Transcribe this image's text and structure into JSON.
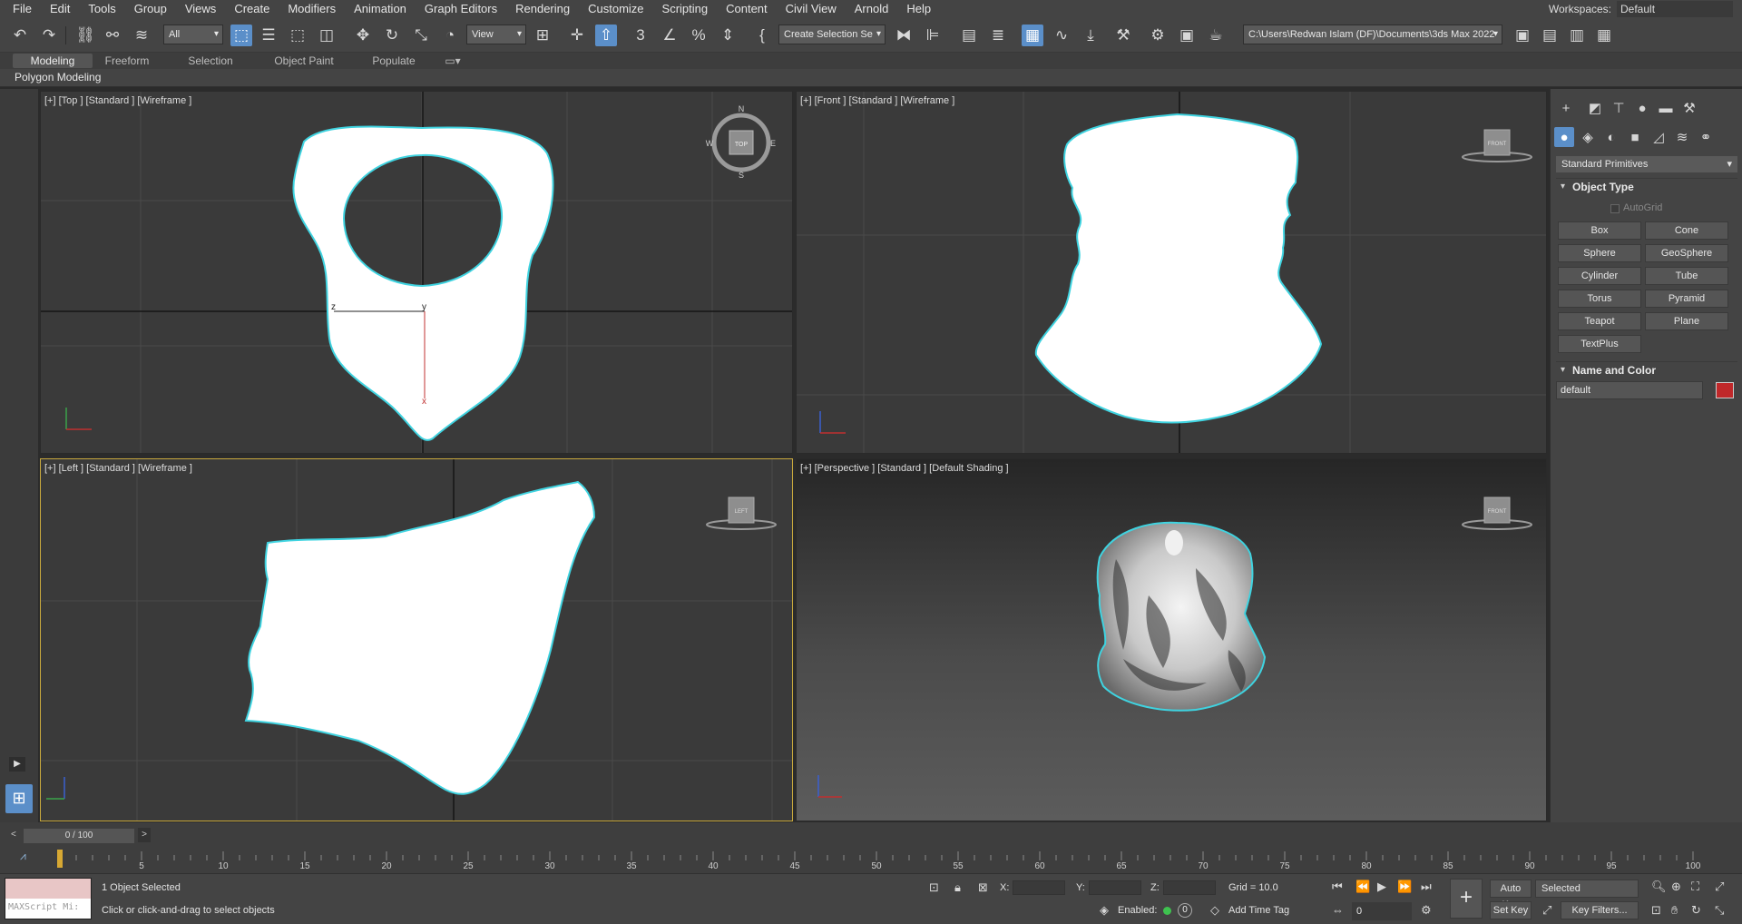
{
  "menubar": {
    "items": [
      "File",
      "Edit",
      "Tools",
      "Group",
      "Views",
      "Create",
      "Modifiers",
      "Animation",
      "Graph Editors",
      "Rendering",
      "Customize",
      "Scripting",
      "Content",
      "Civil View",
      "Arnold",
      "Help"
    ],
    "workspace_label": "Workspaces:",
    "workspace_value": "Default"
  },
  "toolbar": {
    "filter_select": "All",
    "ref_coord_select": "View",
    "selection_set_select": "Create Selection Se",
    "project_path": "C:\\Users\\Redwan Islam (DF)\\Documents\\3ds Max 2022"
  },
  "ribbon": {
    "tabs": [
      "Modeling",
      "Freeform",
      "Selection",
      "Object Paint",
      "Populate"
    ],
    "panel_label": "Polygon Modeling"
  },
  "viewports": {
    "top": {
      "label": "[+] [Top ] [Standard ] [Wireframe ]",
      "gizmo": {
        "n": "N",
        "s": "S",
        "e": "E",
        "w": "W",
        "cube": "TOP"
      },
      "axis_z": "z",
      "axis_y": "y",
      "axis_x": "x"
    },
    "front": {
      "label": "[+] [Front ] [Standard ] [Wireframe ]",
      "cube": "FRONT"
    },
    "left": {
      "label": "[+] [Left ] [Standard ] [Wireframe ]",
      "cube": "LEFT"
    },
    "persp": {
      "label": "[+] [Perspective ] [Standard ] [Default Shading ]",
      "cube": "FRONT"
    }
  },
  "command_panel": {
    "category_select": "Standard Primitives",
    "object_type_title": "Object Type",
    "autogrid_label": "AutoGrid",
    "buttons": [
      "Box",
      "Cone",
      "Sphere",
      "GeoSphere",
      "Cylinder",
      "Tube",
      "Torus",
      "Pyramid",
      "Teapot",
      "Plane",
      "TextPlus"
    ],
    "name_color_title": "Name and Color",
    "object_name": "default",
    "object_color": "#c0282a"
  },
  "timeline": {
    "slider_label": "0 / 100",
    "ticks": [
      "5",
      "10",
      "15",
      "20",
      "25",
      "30",
      "35",
      "40",
      "45",
      "50",
      "55",
      "60",
      "65",
      "70",
      "75",
      "80",
      "85",
      "90",
      "95",
      "100"
    ]
  },
  "statusbar": {
    "maxscript_label": "MAXScript Mi:",
    "selected_text": "1 Object Selected",
    "prompt_text": "Click or click-and-drag to select objects",
    "x_label": "X:",
    "y_label": "Y:",
    "z_label": "Z:",
    "grid_text": "Grid = 10.0",
    "enabled_label": "Enabled:",
    "enabled_value": "0",
    "add_time_tag": "Add Time Tag",
    "auto_key": "Auto Key",
    "set_key": "Set Key",
    "key_mode_select": "Selected",
    "frame_value": "0",
    "key_filters": "Key Filters..."
  },
  "colors": {
    "accent": "#5b8fc9",
    "selection_outline": "#3fd3e0",
    "active_viewport_border": "#c9a93d"
  }
}
